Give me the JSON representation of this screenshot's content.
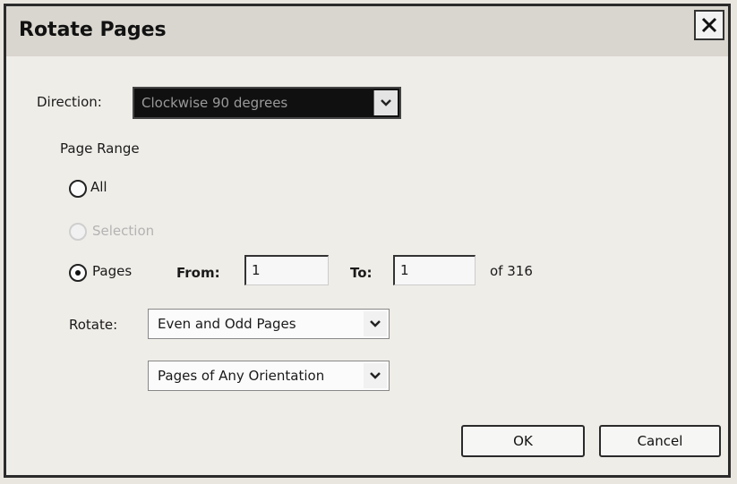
{
  "dialog": {
    "title": "Rotate Pages"
  },
  "direction": {
    "label": "Direction:",
    "value": "Clockwise 90 degrees"
  },
  "page_range": {
    "label": "Page Range",
    "options": [
      {
        "label": "All",
        "checked": false,
        "enabled": true
      },
      {
        "label": "Selection",
        "checked": false,
        "enabled": false
      },
      {
        "label": "Pages",
        "checked": true,
        "enabled": true
      }
    ],
    "from_label": "From:",
    "from_value": "1",
    "to_label": "To:",
    "to_value": "1",
    "of_text": "of 316"
  },
  "rotate": {
    "label": "Rotate:",
    "pages_value": "Even and Odd Pages",
    "orientation_value": "Pages of Any Orientation"
  },
  "buttons": {
    "ok": "OK",
    "cancel": "Cancel"
  },
  "icons": {
    "close": "close-icon",
    "dropdown": "chevron-down-icon"
  }
}
